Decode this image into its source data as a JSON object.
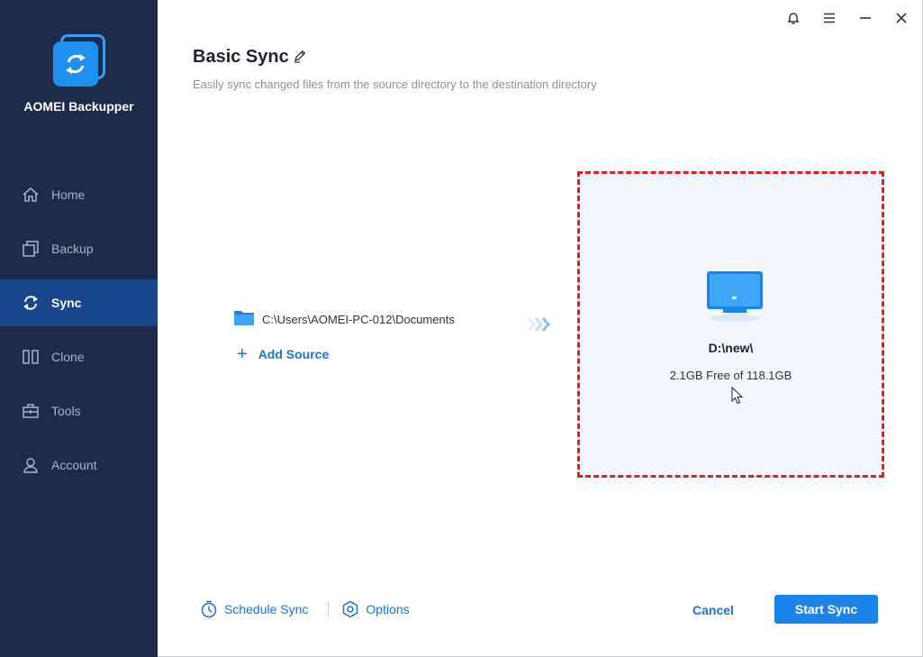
{
  "app": {
    "name": "AOMEI Backupper"
  },
  "sidebar": {
    "items": [
      {
        "label": "Home",
        "icon": "home-icon",
        "active": false
      },
      {
        "label": "Backup",
        "icon": "backup-icon",
        "active": false
      },
      {
        "label": "Sync",
        "icon": "sync-icon",
        "active": true
      },
      {
        "label": "Clone",
        "icon": "clone-icon",
        "active": false
      },
      {
        "label": "Tools",
        "icon": "tools-icon",
        "active": false
      },
      {
        "label": "Account",
        "icon": "account-icon",
        "active": false
      }
    ]
  },
  "window_controls": [
    "bell-icon",
    "menu-icon",
    "minimize-icon",
    "close-icon"
  ],
  "page": {
    "title": "Basic Sync",
    "subtitle": "Easily sync changed files from the source directory to the destination directory"
  },
  "source": {
    "path": "C:\\Users\\AOMEI-PC-012\\Documents",
    "add_label": "Add Source"
  },
  "destination": {
    "path": "D:\\new\\",
    "free_text": "2.1GB Free of 118.1GB"
  },
  "footer": {
    "schedule_label": "Schedule Sync",
    "options_label": "Options",
    "cancel_label": "Cancel",
    "start_label": "Start Sync"
  },
  "colors": {
    "sidebar_bg": "#1e2a4a",
    "sidebar_active": "#17468d",
    "accent": "#1a84ea",
    "highlight_border": "#e01e24",
    "dest_bg": "#f2f7fd"
  }
}
